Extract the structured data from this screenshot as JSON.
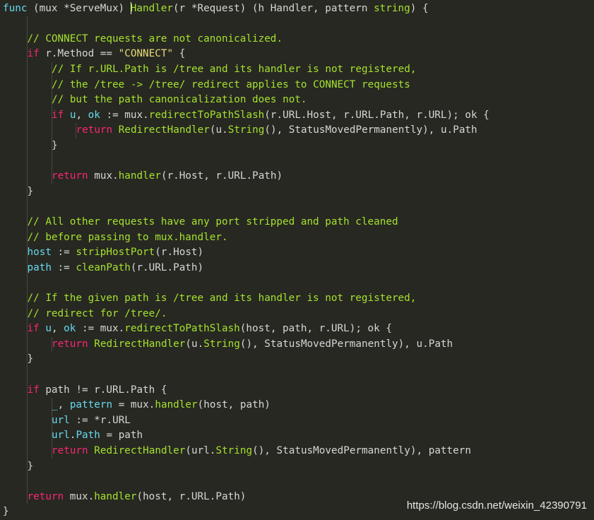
{
  "editor": {
    "colors": {
      "background": "#272822",
      "comment": "#a6e22e",
      "keyword": "#f92672",
      "func_keyword": "#c678dd",
      "function": "#a6e22e",
      "type": "#a6e22e",
      "string": "#e6db74",
      "variable": "#66d9ef",
      "text": "#d6d6d6"
    },
    "lines": [
      {
        "indent": 0,
        "tokens": [
          [
            "keyword-blue",
            "func"
          ],
          [
            "punc",
            " (mux *ServeMux) "
          ],
          [
            "cursor",
            ""
          ],
          [
            "func",
            "Handler"
          ],
          [
            "punc",
            "(r *Request) (h Handler, pattern "
          ],
          [
            "type",
            "string"
          ],
          [
            "punc",
            ") {"
          ]
        ]
      },
      {
        "indent": 0,
        "tokens": []
      },
      {
        "indent": 1,
        "tokens": [
          [
            "comment",
            "// CONNECT requests are not canonicalized."
          ]
        ]
      },
      {
        "indent": 1,
        "tokens": [
          [
            "keyword",
            "if"
          ],
          [
            "punc",
            " r.Method == "
          ],
          [
            "string",
            "\"CONNECT\""
          ],
          [
            "punc",
            " {"
          ]
        ]
      },
      {
        "indent": 2,
        "tokens": [
          [
            "comment",
            "// If r.URL.Path is /tree and its handler is not registered,"
          ]
        ]
      },
      {
        "indent": 2,
        "tokens": [
          [
            "comment",
            "// the /tree -> /tree/ redirect applies to CONNECT requests"
          ]
        ]
      },
      {
        "indent": 2,
        "tokens": [
          [
            "comment",
            "// but the path canonicalization does not."
          ]
        ]
      },
      {
        "indent": 2,
        "tokens": [
          [
            "keyword",
            "if"
          ],
          [
            "punc",
            " "
          ],
          [
            "var",
            "u"
          ],
          [
            "punc",
            ", "
          ],
          [
            "var",
            "ok"
          ],
          [
            "punc",
            " := mux."
          ],
          [
            "func",
            "redirectToPathSlash"
          ],
          [
            "punc",
            "(r.URL.Host, r.URL.Path, r.URL); ok {"
          ]
        ]
      },
      {
        "indent": 3,
        "tokens": [
          [
            "keyword",
            "return"
          ],
          [
            "punc",
            " "
          ],
          [
            "func",
            "RedirectHandler"
          ],
          [
            "punc",
            "(u."
          ],
          [
            "func",
            "String"
          ],
          [
            "punc",
            "(), StatusMovedPermanently), u.Path"
          ]
        ]
      },
      {
        "indent": 2,
        "tokens": [
          [
            "punc",
            "}"
          ]
        ]
      },
      {
        "indent": 0,
        "tokens": []
      },
      {
        "indent": 2,
        "tokens": [
          [
            "keyword",
            "return"
          ],
          [
            "punc",
            " mux."
          ],
          [
            "func",
            "handler"
          ],
          [
            "punc",
            "(r.Host, r.URL.Path)"
          ]
        ]
      },
      {
        "indent": 1,
        "tokens": [
          [
            "punc",
            "}"
          ]
        ]
      },
      {
        "indent": 0,
        "tokens": []
      },
      {
        "indent": 1,
        "tokens": [
          [
            "comment",
            "// All other requests have any port stripped and path cleaned"
          ]
        ]
      },
      {
        "indent": 1,
        "tokens": [
          [
            "comment",
            "// before passing to mux.handler."
          ]
        ]
      },
      {
        "indent": 1,
        "tokens": [
          [
            "var",
            "host"
          ],
          [
            "punc",
            " := "
          ],
          [
            "func",
            "stripHostPort"
          ],
          [
            "punc",
            "(r.Host)"
          ]
        ]
      },
      {
        "indent": 1,
        "tokens": [
          [
            "var",
            "path"
          ],
          [
            "punc",
            " := "
          ],
          [
            "func",
            "cleanPath"
          ],
          [
            "punc",
            "(r.URL.Path)"
          ]
        ]
      },
      {
        "indent": 0,
        "tokens": []
      },
      {
        "indent": 1,
        "tokens": [
          [
            "comment",
            "// If the given path is /tree and its handler is not registered,"
          ]
        ]
      },
      {
        "indent": 1,
        "tokens": [
          [
            "comment",
            "// redirect for /tree/."
          ]
        ]
      },
      {
        "indent": 1,
        "tokens": [
          [
            "keyword",
            "if"
          ],
          [
            "punc",
            " "
          ],
          [
            "var",
            "u"
          ],
          [
            "punc",
            ", "
          ],
          [
            "var",
            "ok"
          ],
          [
            "punc",
            " := mux."
          ],
          [
            "func",
            "redirectToPathSlash"
          ],
          [
            "punc",
            "(host, path, r.URL); ok {"
          ]
        ]
      },
      {
        "indent": 2,
        "tokens": [
          [
            "keyword",
            "return"
          ],
          [
            "punc",
            " "
          ],
          [
            "func",
            "RedirectHandler"
          ],
          [
            "punc",
            "(u."
          ],
          [
            "func",
            "String"
          ],
          [
            "punc",
            "(), StatusMovedPermanently), u.Path"
          ]
        ]
      },
      {
        "indent": 1,
        "tokens": [
          [
            "punc",
            "}"
          ]
        ]
      },
      {
        "indent": 0,
        "tokens": []
      },
      {
        "indent": 1,
        "tokens": [
          [
            "keyword",
            "if"
          ],
          [
            "punc",
            " path != r.URL.Path {"
          ]
        ]
      },
      {
        "indent": 2,
        "tokens": [
          [
            "var",
            "_"
          ],
          [
            "punc",
            ", "
          ],
          [
            "var",
            "pattern"
          ],
          [
            "punc",
            " = mux."
          ],
          [
            "func",
            "handler"
          ],
          [
            "punc",
            "(host, path)"
          ]
        ]
      },
      {
        "indent": 2,
        "tokens": [
          [
            "var",
            "url"
          ],
          [
            "punc",
            " := *r.URL"
          ]
        ]
      },
      {
        "indent": 2,
        "tokens": [
          [
            "var",
            "url"
          ],
          [
            "punc",
            "."
          ],
          [
            "var",
            "Path"
          ],
          [
            "punc",
            " = path"
          ]
        ]
      },
      {
        "indent": 2,
        "tokens": [
          [
            "keyword",
            "return"
          ],
          [
            "punc",
            " "
          ],
          [
            "func",
            "RedirectHandler"
          ],
          [
            "punc",
            "(url."
          ],
          [
            "func",
            "String"
          ],
          [
            "punc",
            "(), StatusMovedPermanently), pattern"
          ]
        ]
      },
      {
        "indent": 1,
        "tokens": [
          [
            "punc",
            "}"
          ]
        ]
      },
      {
        "indent": 0,
        "tokens": []
      },
      {
        "indent": 1,
        "tokens": [
          [
            "keyword",
            "return"
          ],
          [
            "punc",
            " mux."
          ],
          [
            "func",
            "handler"
          ],
          [
            "punc",
            "(host, r.URL.Path)"
          ]
        ]
      },
      {
        "indent": 0,
        "tokens": [
          [
            "punc",
            "}"
          ]
        ]
      }
    ]
  },
  "watermark": "https://blog.csdn.net/weixin_42390791"
}
